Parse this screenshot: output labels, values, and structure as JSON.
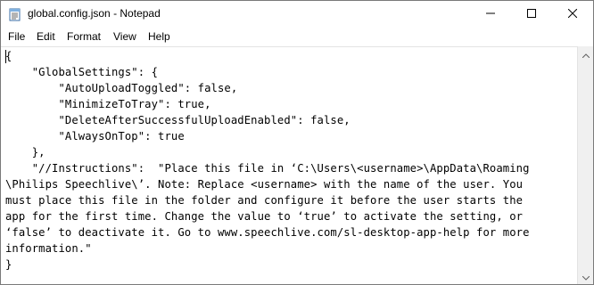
{
  "window": {
    "title": "global.config.json - Notepad",
    "app_icon": "notepad-icon"
  },
  "caption_buttons": {
    "minimize_icon": "minimize-icon",
    "maximize_icon": "maximize-icon",
    "close_icon": "close-icon"
  },
  "menu": {
    "items": [
      {
        "label": "File"
      },
      {
        "label": "Edit"
      },
      {
        "label": "Format"
      },
      {
        "label": "View"
      },
      {
        "label": "Help"
      }
    ]
  },
  "editor": {
    "lines": [
      "{",
      "    \"GlobalSettings\": {",
      "        \"AutoUploadToggled\": false,",
      "        \"MinimizeToTray\": true,",
      "        \"DeleteAfterSuccessfulUploadEnabled\": false,",
      "        \"AlwaysOnTop\": true",
      "    },",
      "    \"//Instructions\":  \"Place this file in ‘C:\\Users\\<username>\\AppData\\Roaming",
      "\\Philips Speechlive\\’. Note: Replace <username> with the name of the user. You",
      "must place this file in the folder and configure it before the user starts the",
      "app for the first time. Change the value to ‘true’ to activate the setting, or",
      "‘false’ to deactivate it. Go to www.speechlive.com/sl-desktop-app-help for more",
      "information.\"",
      "}"
    ]
  },
  "scrollbar": {
    "up_icon": "scroll-up-arrow-icon",
    "down_icon": "scroll-down-arrow-icon"
  }
}
